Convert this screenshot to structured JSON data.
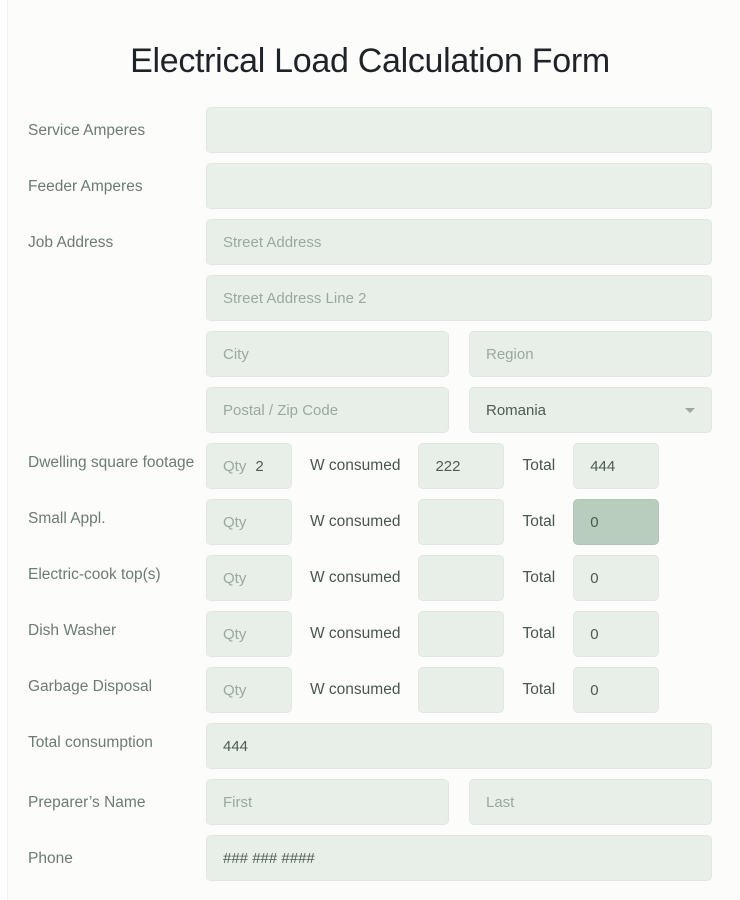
{
  "form": {
    "title": "Electrical Load Calculation Form",
    "service_amperes": {
      "label": "Service Amperes",
      "placeholder": "",
      "value": ""
    },
    "feeder_amperes": {
      "label": "Feeder Amperes",
      "placeholder": "",
      "value": ""
    },
    "job_address": {
      "label": "Job Address",
      "street1_placeholder": "Street Address",
      "street1_value": "",
      "street2_placeholder": "Street Address Line 2",
      "street2_value": "",
      "city_placeholder": "City",
      "city_value": "",
      "region_placeholder": "Region",
      "region_value": "",
      "postal_placeholder": "Postal / Zip Code",
      "postal_value": "",
      "country_selected": "Romania",
      "country_icon": "chevron-down-icon"
    },
    "appliance_headers": {
      "qty_placeholder": "Qty",
      "w_consumed_label": "W consumed",
      "total_label": "Total"
    },
    "appliances": [
      {
        "label": "Dwelling square footage",
        "qty_placeholder": "Qty",
        "qty_value": "2",
        "w_value": "222",
        "total_value": "444",
        "total_highlighted": false
      },
      {
        "label": "Small Appl.",
        "qty_placeholder": "Qty",
        "qty_value": "",
        "w_value": "",
        "total_value": "0",
        "total_highlighted": true
      },
      {
        "label": "Electric-cook top(s)",
        "qty_placeholder": "Qty",
        "qty_value": "",
        "w_value": "",
        "total_value": "0",
        "total_highlighted": false
      },
      {
        "label": "Dish Washer",
        "qty_placeholder": "Qty",
        "qty_value": "",
        "w_value": "",
        "total_value": "0",
        "total_highlighted": false
      },
      {
        "label": "Garbage Disposal",
        "qty_placeholder": "Qty",
        "qty_value": "",
        "w_value": "",
        "total_value": "0",
        "total_highlighted": false
      }
    ],
    "total_consumption": {
      "label": "Total consumption",
      "value": "444"
    },
    "preparer_name": {
      "label": "Preparer’s Name",
      "first_placeholder": "First",
      "first_value": "",
      "last_placeholder": "Last",
      "last_value": ""
    },
    "phone": {
      "label": "Phone",
      "value": "### ### ####"
    }
  },
  "colors": {
    "page_background": "#fcfcfb",
    "input_background": "#e8efe9",
    "input_border": "#dfe7e0",
    "input_highlight": "#b9cdbe",
    "label_text": "#6c7b74",
    "value_text": "#4e5a54",
    "placeholder_text": "#9aa8a0",
    "title_text": "#1f2328"
  }
}
